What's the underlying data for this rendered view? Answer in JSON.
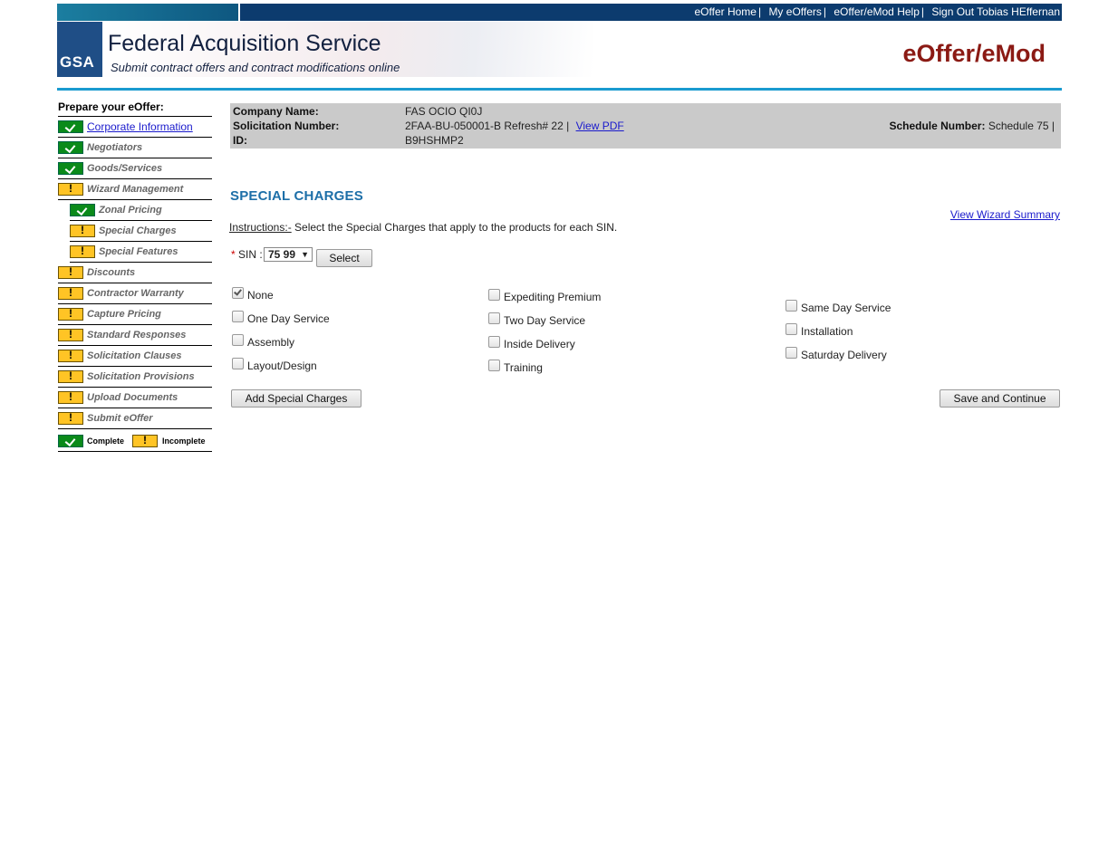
{
  "topnav": {
    "home": "eOffer Home",
    "my_eoffers": "My eOffers",
    "help": "eOffer/eMod Help",
    "sign_out": "Sign Out Tobias HEffernan",
    "sep": "|"
  },
  "header": {
    "logo_text": "GSA",
    "title": "Federal Acquisition Service",
    "tagline": "Submit contract offers and contract modifications online",
    "app_name": "eOffer/eMod"
  },
  "sidebar": {
    "title": "Prepare your eOffer:",
    "items": [
      {
        "label": "Corporate Information",
        "status": "complete"
      },
      {
        "label": "Negotiators",
        "status": "complete"
      },
      {
        "label": "Goods/Services",
        "status": "complete"
      },
      {
        "label": "Wizard Management",
        "status": "incomplete"
      },
      {
        "label": "Zonal Pricing",
        "status": "complete"
      },
      {
        "label": "Special Charges",
        "status": "incomplete"
      },
      {
        "label": "Special Features",
        "status": "incomplete"
      },
      {
        "label": "Discounts",
        "status": "incomplete"
      },
      {
        "label": "Contractor Warranty",
        "status": "incomplete"
      },
      {
        "label": "Capture Pricing",
        "status": "incomplete"
      },
      {
        "label": "Standard Responses",
        "status": "incomplete"
      },
      {
        "label": "Solicitation Clauses",
        "status": "incomplete"
      },
      {
        "label": "Solicitation Provisions",
        "status": "incomplete"
      },
      {
        "label": "Upload Documents",
        "status": "incomplete"
      },
      {
        "label": "Submit eOffer",
        "status": "incomplete"
      }
    ],
    "legend": {
      "complete": "Complete",
      "incomplete": "Incomplete"
    }
  },
  "info": {
    "company_label": "Company Name:",
    "company_value": "FAS OCIO QI0J",
    "solicitation_label": "Solicitation Number:",
    "solicitation_value": "2FAA-BU-050001-B Refresh# 22 |",
    "view_pdf": "View PDF",
    "id_label": "ID:",
    "id_value": "B9HSHMP2",
    "schedule_label": "Schedule Number:",
    "schedule_value": "Schedule 75 |"
  },
  "main": {
    "title": "SPECIAL CHARGES",
    "view_wizard_summary": "View Wizard Summary",
    "instructions_label": "Instructions:-",
    "instructions_text": " Select the Special Charges that apply to the products for each SIN.",
    "sin_required": "*",
    "sin_label": "SIN :",
    "sin_value": "75 99",
    "select_button": "Select",
    "charges": [
      {
        "label": "None",
        "checked": true
      },
      {
        "label": "One Day Service",
        "checked": false
      },
      {
        "label": "Assembly",
        "checked": false
      },
      {
        "label": "Layout/Design",
        "checked": false
      },
      {
        "label": "Expediting Premium",
        "checked": false
      },
      {
        "label": "Two Day Service",
        "checked": false
      },
      {
        "label": "Inside Delivery",
        "checked": false
      },
      {
        "label": "Training",
        "checked": false
      },
      {
        "label": "Same Day Service",
        "checked": false
      },
      {
        "label": "Installation",
        "checked": false
      },
      {
        "label": "Saturday Delivery",
        "checked": false
      }
    ],
    "add_button": "Add Special Charges",
    "save_button": "Save and Continue"
  }
}
